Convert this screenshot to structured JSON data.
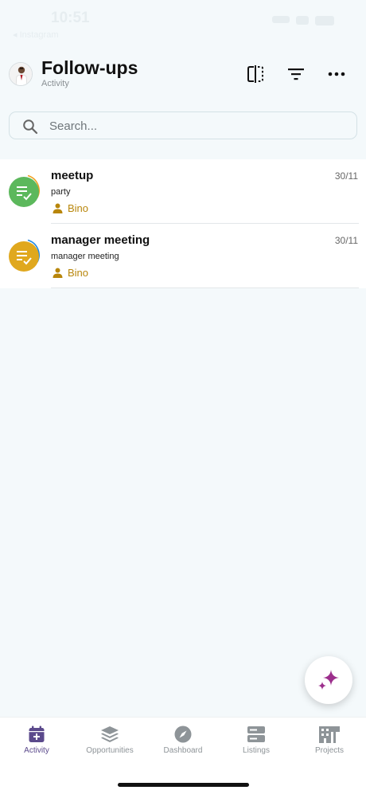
{
  "status_bar": {
    "time": "10:51",
    "back_app": "◂ Instagram"
  },
  "header": {
    "title": "Follow-ups",
    "subtitle": "Activity",
    "icons": [
      "split-view-icon",
      "filter-icon",
      "more-icon"
    ]
  },
  "search": {
    "placeholder": "Search..."
  },
  "followups": [
    {
      "title": "meetup",
      "description": "party",
      "owner": "Bino",
      "date": "30/11",
      "icon_color": "#5cb85c",
      "ring_color": "#f0a020"
    },
    {
      "title": "manager meeting",
      "description": "manager meeting",
      "owner": "Bino",
      "date": "30/11",
      "icon_color": "#e0a81e",
      "ring_color": "#1e88e5"
    }
  ],
  "nav": {
    "tabs": [
      {
        "label": "Activity",
        "icon": "calendar-plus-icon",
        "active": true
      },
      {
        "label": "Opportunities",
        "icon": "layers-icon",
        "active": false
      },
      {
        "label": "Dashboard",
        "icon": "compass-icon",
        "active": false
      },
      {
        "label": "Listings",
        "icon": "server-icon",
        "active": false
      },
      {
        "label": "Projects",
        "icon": "building-icon",
        "active": false
      }
    ]
  },
  "colors": {
    "accent": "#5b4a8c",
    "owner": "#b8860b",
    "fab_star": "#9c2e8c"
  }
}
